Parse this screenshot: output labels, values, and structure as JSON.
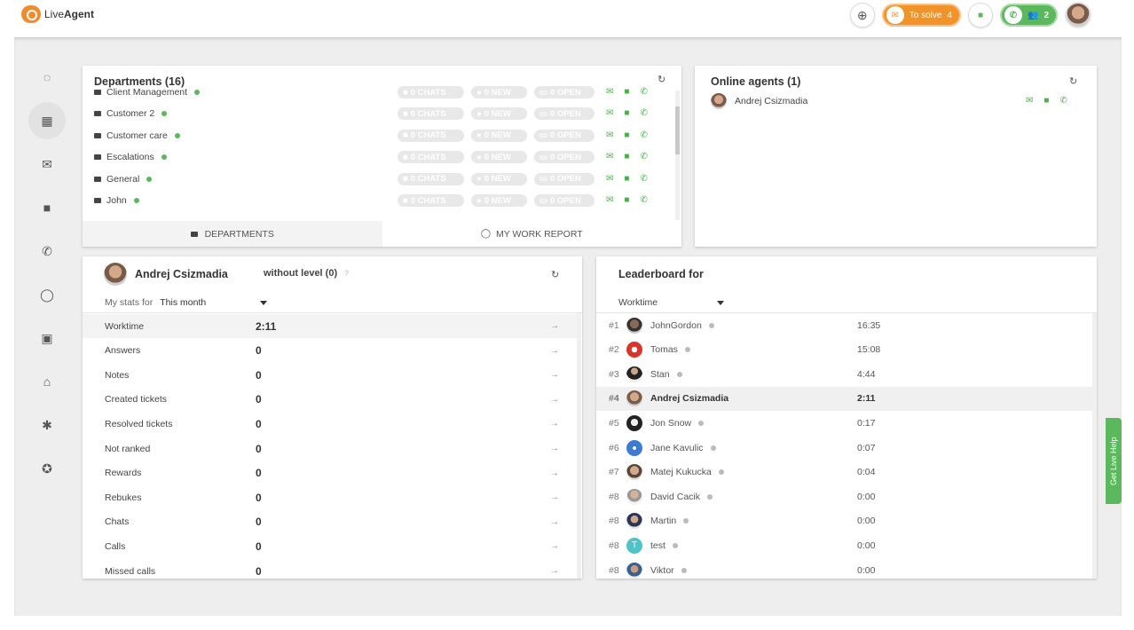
{
  "app": {
    "logo_text_light": "Live",
    "logo_text_bold": "Agent"
  },
  "topbar": {
    "to_solve_label": "To solve",
    "to_solve_count": "4",
    "agents_count": "2"
  },
  "departments": {
    "title": "Departments (16)",
    "items": [
      {
        "name": "Client Management",
        "chats": "0 CHATS",
        "new": "0 NEW",
        "open": "0 OPEN"
      },
      {
        "name": "Customer 2",
        "chats": "0 CHATS",
        "new": "0 NEW",
        "open": "0 OPEN"
      },
      {
        "name": "Customer care",
        "chats": "0 CHATS",
        "new": "0 NEW",
        "open": "0 OPEN"
      },
      {
        "name": "Escalations",
        "chats": "0 CHATS",
        "new": "0 NEW",
        "open": "0 OPEN"
      },
      {
        "name": "General",
        "chats": "0 CHATS",
        "new": "0 NEW",
        "open": "0 OPEN"
      },
      {
        "name": "John",
        "chats": "0 CHATS",
        "new": "0 NEW",
        "open": "0 OPEN"
      }
    ],
    "tab_departments": "DEPARTMENTS",
    "tab_report": "MY WORK REPORT"
  },
  "online_agents": {
    "title": "Online agents (1)",
    "items": [
      {
        "name": "Andrej Csizmadia"
      }
    ]
  },
  "my_stats": {
    "agent_name": "Andrej Csizmadia",
    "level": "without level (0)",
    "help": "?",
    "stats_for_label": "My stats for",
    "period": "This month",
    "rows": [
      {
        "label": "Worktime",
        "value": "2:11"
      },
      {
        "label": "Answers",
        "value": "0"
      },
      {
        "label": "Notes",
        "value": "0"
      },
      {
        "label": "Created tickets",
        "value": "0"
      },
      {
        "label": "Resolved tickets",
        "value": "0"
      },
      {
        "label": "Not ranked",
        "value": "0"
      },
      {
        "label": "Rewards",
        "value": "0"
      },
      {
        "label": "Rebukes",
        "value": "0"
      },
      {
        "label": "Chats",
        "value": "0"
      },
      {
        "label": "Calls",
        "value": "0"
      },
      {
        "label": "Missed calls",
        "value": "0"
      }
    ]
  },
  "leaderboard": {
    "title": "Leaderboard for",
    "metric": "Worktime",
    "rows": [
      {
        "rank": "#1",
        "name": "JohnGordon",
        "time": "16:35"
      },
      {
        "rank": "#2",
        "name": "Tomas",
        "time": "15:08"
      },
      {
        "rank": "#3",
        "name": "Stan",
        "time": "4:44"
      },
      {
        "rank": "#4",
        "name": "Andrej Csizmadia",
        "time": "2:11"
      },
      {
        "rank": "#5",
        "name": "Jon Snow",
        "time": "0:17"
      },
      {
        "rank": "#6",
        "name": "Jane Kavulic",
        "time": "0:07"
      },
      {
        "rank": "#7",
        "name": "Matej Kukucka",
        "time": "0:04"
      },
      {
        "rank": "#8",
        "name": "David Cacik",
        "time": "0:00"
      },
      {
        "rank": "#8",
        "name": "Martin",
        "time": "0:00"
      },
      {
        "rank": "#8",
        "name": "test",
        "time": "0:00",
        "initial": "T"
      },
      {
        "rank": "#8",
        "name": "Viktor",
        "time": "0:00"
      }
    ]
  },
  "get_live_help": "Get Live Help",
  "colors": {
    "accent_orange": "#f0932b",
    "accent_green": "#5cb85c"
  }
}
